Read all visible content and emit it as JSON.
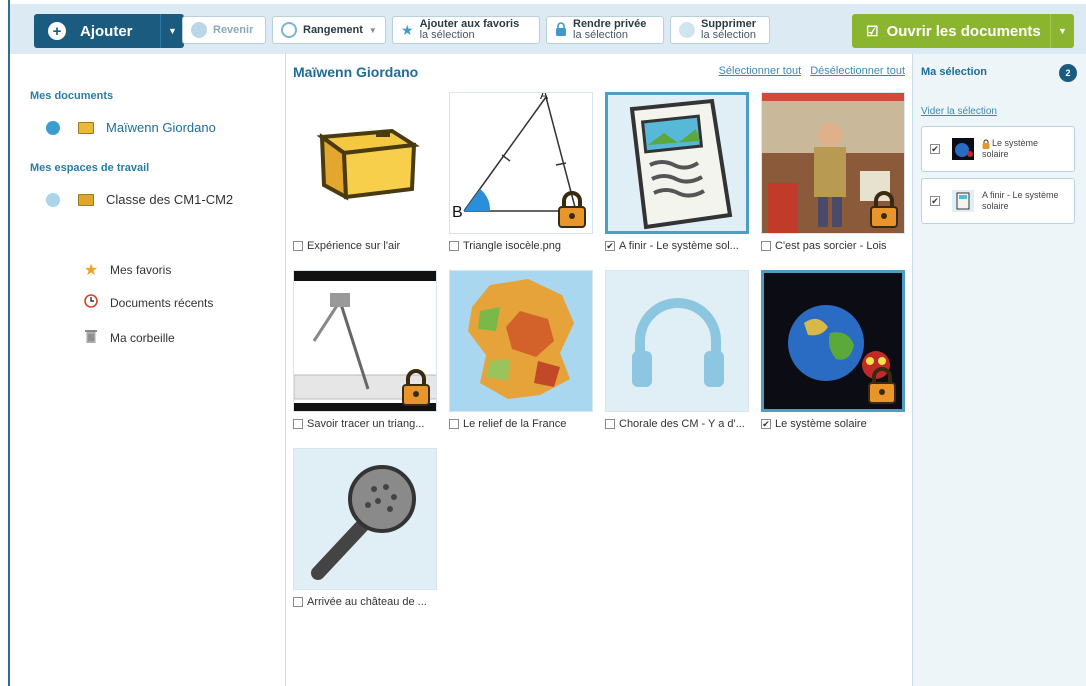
{
  "toolbar": {
    "add_label": "Ajouter",
    "back_label": "Revenir",
    "sort_label": "Rangement",
    "fav_label_1": "Ajouter aux favoris",
    "fav_label_2": "la sélection",
    "private_label_1": "Rendre privée",
    "private_label_2": "la sélection",
    "delete_label_1": "Supprimer",
    "delete_label_2": "la sélection",
    "open_label": "Ouvrir les documents"
  },
  "sidebar": {
    "my_docs_heading": "Mes documents",
    "my_docs_item": "Maïwenn Giordano",
    "workspaces_heading": "Mes espaces de travail",
    "workspace_item": "Classe des CM1-CM2",
    "links": [
      {
        "label": "Mes favoris",
        "icon": "star-icon"
      },
      {
        "label": "Documents récents",
        "icon": "clock-icon"
      },
      {
        "label": "Ma corbeille",
        "icon": "trash-icon"
      }
    ]
  },
  "main": {
    "title": "Maïwenn Giordano",
    "select_all": "Sélectionner tout",
    "deselect_all": "Désélectionner tout",
    "files": [
      {
        "name": "Expérience sur l'air",
        "checked": false,
        "kind": "folder"
      },
      {
        "name": "Triangle isocèle.png",
        "checked": false,
        "kind": "triangle",
        "locked": true
      },
      {
        "name": "A finir - Le système sol...",
        "checked": true,
        "kind": "document"
      },
      {
        "name": "C'est pas sorcier - Lois",
        "checked": false,
        "kind": "video",
        "locked": true
      },
      {
        "name": "Savoir tracer un triang...",
        "checked": false,
        "kind": "compass",
        "locked": true
      },
      {
        "name": "Le relief de la France",
        "checked": false,
        "kind": "map"
      },
      {
        "name": "Chorale des CM - Y a d'...",
        "checked": false,
        "kind": "audio"
      },
      {
        "name": "Le système solaire",
        "checked": true,
        "kind": "earth",
        "locked": true
      },
      {
        "name": "Arrivée au château de ...",
        "checked": false,
        "kind": "microphone"
      }
    ]
  },
  "selection": {
    "title": "Ma sélection",
    "count": "2",
    "clear": "Vider la sélection",
    "items": [
      {
        "label_1": "Le système",
        "label_2": "solaire"
      },
      {
        "label_1": "A finir - Le système",
        "label_2": "solaire"
      }
    ]
  },
  "colors": {
    "primary": "#1b5b80",
    "accent_green": "#8bb52f",
    "toolbar_bg": "#dcebf3",
    "link_blue": "#3b8ab6"
  }
}
